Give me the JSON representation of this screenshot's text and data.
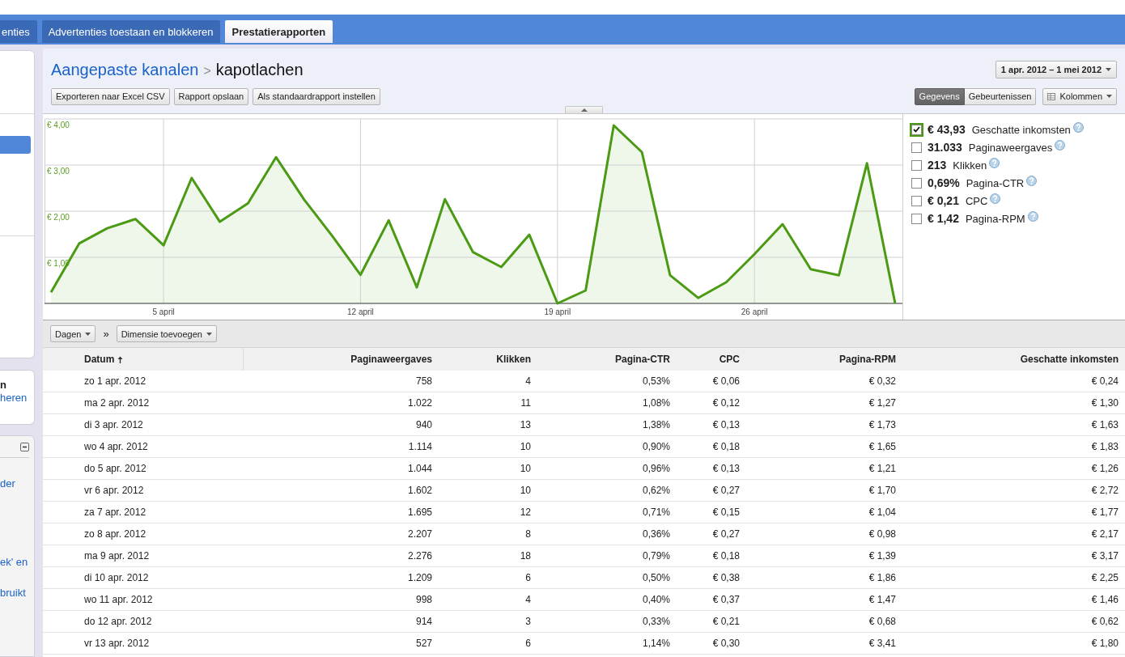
{
  "tabs": [
    {
      "label": "enties",
      "selected": false
    },
    {
      "label": "Advertenties toestaan en blokkeren",
      "selected": false
    },
    {
      "label": "Prestatierapporten",
      "selected": true
    }
  ],
  "sidebar": {
    "menu_items": [
      {
        "selected": true
      }
    ],
    "info_panel": {
      "heading": "n",
      "link": "heren"
    },
    "help_panel": {
      "expanded": true,
      "links": [
        "der",
        "ek' en",
        "bruikt"
      ]
    }
  },
  "header": {
    "breadcrumb": {
      "parent": "Aangepaste kanalen",
      "separator": ">",
      "current": "kapotlachen"
    },
    "date_range": "1 apr. 2012 – 1 mei 2012",
    "buttons": [
      "Exporteren naar Excel CSV",
      "Rapport opslaan",
      "Als standaardrapport instellen"
    ],
    "view_toggle": [
      {
        "label": "Gegevens",
        "selected": true
      },
      {
        "label": "Gebeurtenissen",
        "selected": false
      }
    ],
    "columns_button": "Kolommen"
  },
  "chart": {
    "chart_data": {
      "type": "area",
      "categories": [
        null,
        null,
        null,
        null,
        "5 april",
        null,
        null,
        null,
        null,
        null,
        null,
        "12 april",
        null,
        null,
        null,
        null,
        null,
        null,
        "19 april",
        null,
        null,
        null,
        null,
        null,
        null,
        "26 april",
        null,
        null,
        null,
        null,
        null
      ],
      "values": [
        0.24,
        1.3,
        1.63,
        1.83,
        1.26,
        2.72,
        1.77,
        2.17,
        3.17,
        2.25,
        1.46,
        0.62,
        1.8,
        0.35,
        2.26,
        1.11,
        0.79,
        1.49,
        0.0,
        0.28,
        3.86,
        3.28,
        0.61,
        0.12,
        0.46,
        1.07,
        1.72,
        0.74,
        0.61,
        3.04,
        0.0
      ],
      "ylim": [
        0,
        4
      ],
      "yticks": [
        {
          "value": 1,
          "label": "€ 1,00"
        },
        {
          "value": 2,
          "label": "€ 2,00"
        },
        {
          "value": 3,
          "label": "€ 3,00"
        },
        {
          "value": 4,
          "label": "€ 4,00"
        }
      ],
      "grid": true
    },
    "legend": [
      {
        "total": "€ 43,93",
        "metric": "Geschatte inkomsten",
        "checked": true
      },
      {
        "total": "31.033",
        "metric": "Paginaweergaves",
        "checked": false
      },
      {
        "total": "213",
        "metric": "Klikken",
        "checked": false
      },
      {
        "total": "0,69%",
        "metric": "Pagina-CTR",
        "checked": false
      },
      {
        "total": "€ 0,21",
        "metric": "CPC",
        "checked": false
      },
      {
        "total": "€ 1,42",
        "metric": "Pagina-RPM",
        "checked": false
      }
    ]
  },
  "toolbar": {
    "granularity": "Dagen",
    "separator": "»",
    "add_dimension": "Dimensie toevoegen"
  },
  "table": {
    "columns": [
      {
        "label": "Datum",
        "sorted": true
      },
      {
        "label": "Paginaweergaves",
        "sorted": false
      },
      {
        "label": "Klikken",
        "sorted": false
      },
      {
        "label": "Pagina-CTR",
        "sorted": false
      },
      {
        "label": "CPC",
        "sorted": false
      },
      {
        "label": "Pagina-RPM",
        "sorted": false
      },
      {
        "label": "Geschatte inkomsten",
        "sorted": false
      }
    ],
    "rows": [
      [
        "zo 1 apr. 2012",
        "758",
        "4",
        "0,53%",
        "€ 0,06",
        "€ 0,32",
        "€ 0,24"
      ],
      [
        "ma 2 apr. 2012",
        "1.022",
        "11",
        "1,08%",
        "€ 0,12",
        "€ 1,27",
        "€ 1,30"
      ],
      [
        "di 3 apr. 2012",
        "940",
        "13",
        "1,38%",
        "€ 0,13",
        "€ 1,73",
        "€ 1,63"
      ],
      [
        "wo 4 apr. 2012",
        "1.114",
        "10",
        "0,90%",
        "€ 0,18",
        "€ 1,65",
        "€ 1,83"
      ],
      [
        "do 5 apr. 2012",
        "1.044",
        "10",
        "0,96%",
        "€ 0,13",
        "€ 1,21",
        "€ 1,26"
      ],
      [
        "vr 6 apr. 2012",
        "1.602",
        "10",
        "0,62%",
        "€ 0,27",
        "€ 1,70",
        "€ 2,72"
      ],
      [
        "za 7 apr. 2012",
        "1.695",
        "12",
        "0,71%",
        "€ 0,15",
        "€ 1,04",
        "€ 1,77"
      ],
      [
        "zo 8 apr. 2012",
        "2.207",
        "8",
        "0,36%",
        "€ 0,27",
        "€ 0,98",
        "€ 2,17"
      ],
      [
        "ma 9 apr. 2012",
        "2.276",
        "18",
        "0,79%",
        "€ 0,18",
        "€ 1,39",
        "€ 3,17"
      ],
      [
        "di 10 apr. 2012",
        "1.209",
        "6",
        "0,50%",
        "€ 0,38",
        "€ 1,86",
        "€ 2,25"
      ],
      [
        "wo 11 apr. 2012",
        "998",
        "4",
        "0,40%",
        "€ 0,37",
        "€ 1,47",
        "€ 1,46"
      ],
      [
        "do 12 apr. 2012",
        "914",
        "3",
        "0,33%",
        "€ 0,21",
        "€ 0,68",
        "€ 0,62"
      ],
      [
        "vr 13 apr. 2012",
        "527",
        "6",
        "1,14%",
        "€ 0,30",
        "€ 3,41",
        "€ 1,80"
      ]
    ]
  }
}
